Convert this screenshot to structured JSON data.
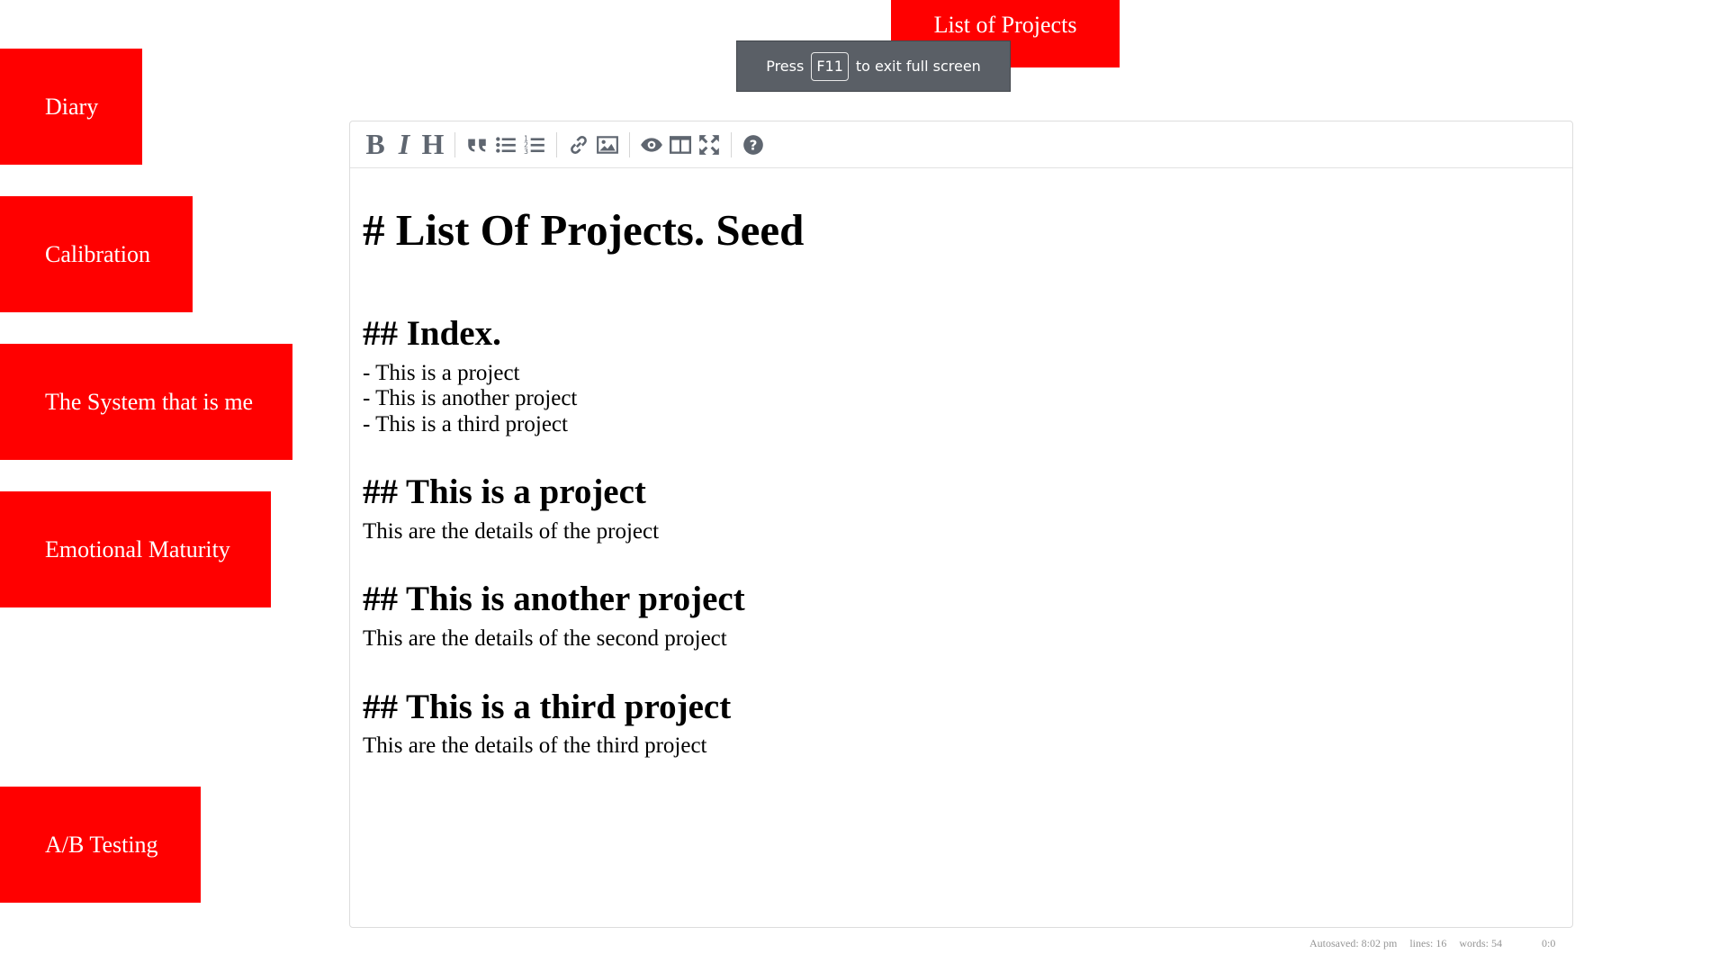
{
  "nav": {
    "diary": "Diary",
    "calibration": "Calibration",
    "system": "The System that is me",
    "emotional": "Emotional Maturity",
    "ab_testing": "A/B Testing",
    "top": "List of Projects"
  },
  "fullscreen_notice": {
    "before": "Press",
    "key": "F11",
    "after": "to exit full screen"
  },
  "toolbar": {
    "bold": "B",
    "italic": "I",
    "heading": "H",
    "icons": [
      "quote-icon",
      "unordered-list-icon",
      "ordered-list-icon",
      "link-icon",
      "image-icon",
      "preview-icon",
      "side-by-side-icon",
      "fullscreen-icon",
      "help-icon"
    ]
  },
  "editor": {
    "title": "# List Of Projects. Seed",
    "index_heading": "## Index.",
    "index_items": [
      "- This is a project",
      "- This is another project",
      "- This is a third project"
    ],
    "sections": [
      {
        "heading": "## This is a project",
        "details": "This are the details of the project"
      },
      {
        "heading": "## This is another project",
        "details": "This are the details of the second project"
      },
      {
        "heading": "## This is a third project",
        "details": "This are the details of the third project"
      }
    ]
  },
  "status": {
    "autosaved": "Autosaved: 8:02 pm",
    "lines": "lines: 16",
    "words": "words: 54",
    "cursor": "0:0"
  },
  "colors": {
    "nav_button": "#ff0000",
    "toast_bg": "#5a5f66",
    "toolbar_icon": "#5f6670"
  }
}
